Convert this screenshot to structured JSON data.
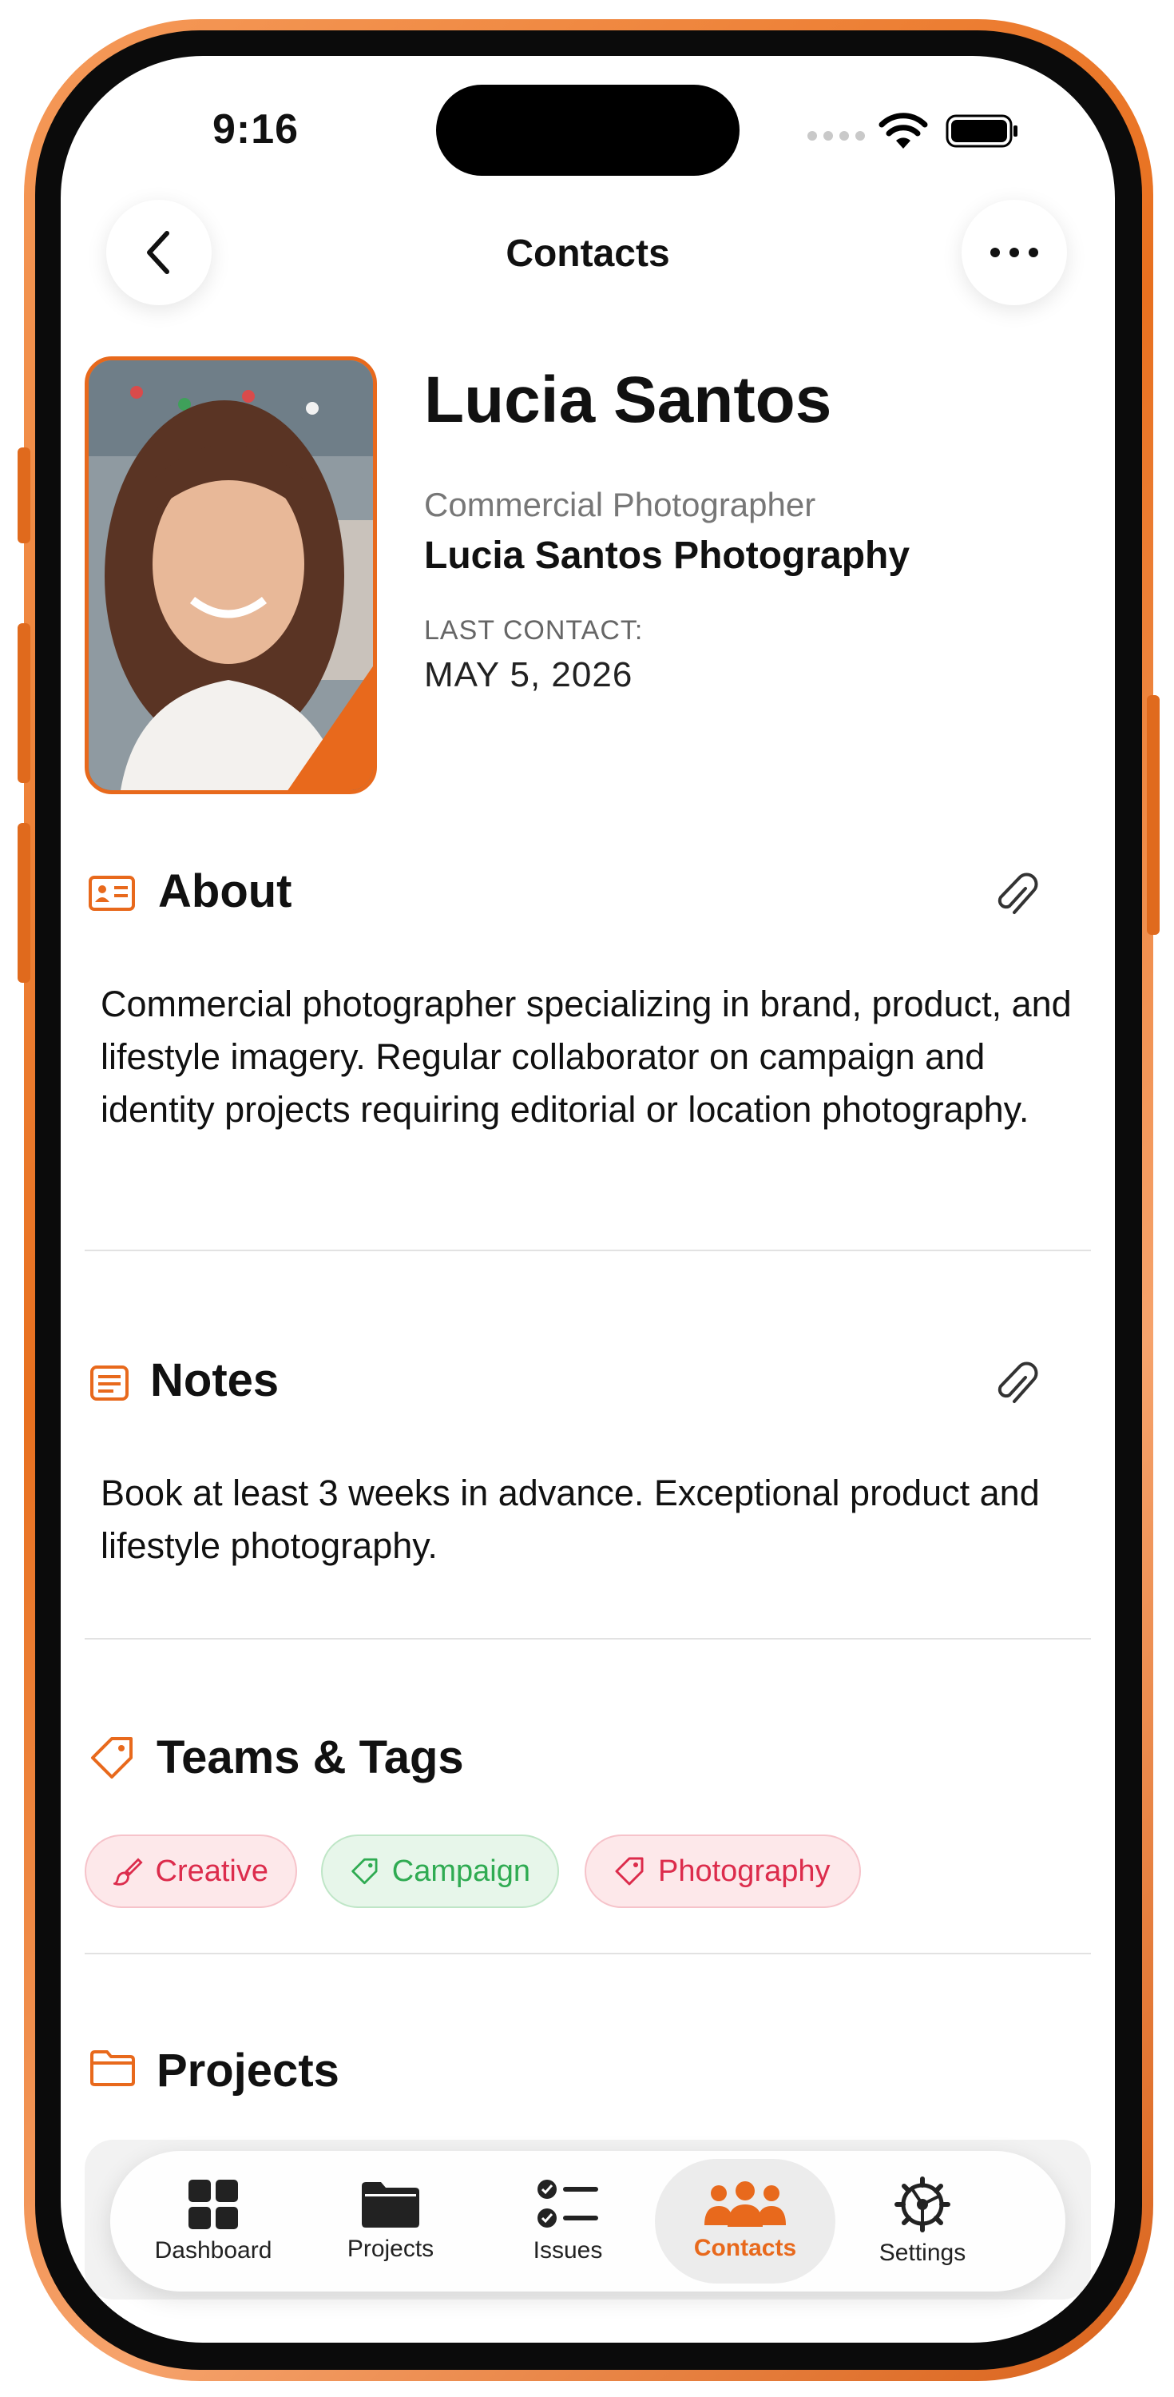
{
  "status_bar": {
    "time": "9:16"
  },
  "nav": {
    "title": "Contacts"
  },
  "profile": {
    "name": "Lucia Santos",
    "role": "Commercial Photographer",
    "company": "Lucia Santos Photography",
    "last_contact_label": "LAST CONTACT:",
    "last_contact_value": "MAY 5, 2026"
  },
  "about": {
    "title": "About",
    "text": "Commercial photographer specializing in brand, product, and lifestyle imagery. Regular collaborator on campaign and identity projects requiring editorial or location photography."
  },
  "notes": {
    "title": "Notes",
    "text": "Book at least 3 weeks in advance. Exceptional product and lifestyle photography."
  },
  "teams_tags": {
    "title": "Teams & Tags",
    "tags": [
      {
        "label": "Creative",
        "icon": "brush-icon",
        "color": "#dc2c4c"
      },
      {
        "label": "Campaign",
        "icon": "tag-icon",
        "color": "#2fab52"
      },
      {
        "label": "Photography",
        "icon": "tag-icon",
        "color": "#dc2c4c"
      }
    ]
  },
  "projects": {
    "title": "Projects"
  },
  "tabbar": {
    "active": "Contacts",
    "accent": "#e8691c",
    "items": [
      {
        "label": "Dashboard",
        "icon": "grid-icon"
      },
      {
        "label": "Projects",
        "icon": "folder-icon"
      },
      {
        "label": "Issues",
        "icon": "checklist-icon"
      },
      {
        "label": "Contacts",
        "icon": "people-icon"
      },
      {
        "label": "Settings",
        "icon": "gear-icon"
      }
    ]
  }
}
